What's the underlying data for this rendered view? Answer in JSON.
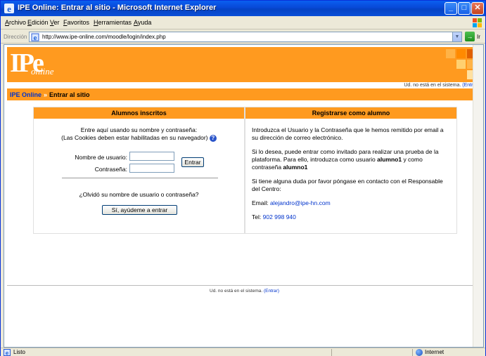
{
  "window": {
    "title": "IPE Online: Entrar al sitio - Microsoft Internet Explorer",
    "minimize": "_",
    "maximize": "□",
    "close": "✕"
  },
  "menu": [
    "Archivo",
    "Edición",
    "Ver",
    "Favoritos",
    "Herramientas",
    "Ayuda"
  ],
  "address": {
    "label": "Dirección",
    "url": "http://www.ipe-online.com/moodle/login/index.php",
    "go_label": "Ir"
  },
  "page": {
    "logo_text": "IPe",
    "logo_word": "online",
    "login_status_top": "Ud. no está en el sistema.",
    "login_link": "(Entrar)",
    "breadcrumb": {
      "home": "IPE Online",
      "sep": "»",
      "current": "Entrar al sitio"
    },
    "left": {
      "heading": "Alumnos inscritos",
      "intro_line1": "Entre aquí usando su nombre y contraseña:",
      "intro_line2": "(Las Cookies deben estar habilitadas en su navegador)",
      "username_label": "Nombre de usuario:",
      "password_label": "Contraseña:",
      "username_value": "",
      "password_value": "",
      "login_button": "Entrar",
      "forgot_text": "¿Olvidó su nombre de usuario o contraseña?",
      "help_button": "Sí, ayúdeme a entrar"
    },
    "right": {
      "heading": "Registrarse como alumno",
      "para1": "Introduzca el Usuario y la Contraseña que le hemos remitido por email a su dirección de correo electrónico.",
      "para2_a": "Si lo desea, puede entrar como invitado para realizar una prueba de la plataforma. Para ello, introduzca como usuario ",
      "para2_user": "alumno1",
      "para2_b": " y como contraseña ",
      "para2_pass": "alumno1",
      "para3": "Si tiene alguna duda por favor póngase en contacto con el Responsable del Centro:",
      "email_label": "Email:",
      "email_value": "alejandro@ipe-hn.com",
      "tel_label": "Tel:",
      "tel_value": "902 998 940"
    },
    "login_status_bottom": "Ud. no está en el sistema.",
    "login_link_bottom": "(Entrar)"
  },
  "status": {
    "text": "Listo",
    "zone": "Internet"
  },
  "colors": {
    "brand_orange": "#ff9a1f",
    "link_blue": "#0033cc",
    "titlebar_blue": "#0a5ff0"
  }
}
